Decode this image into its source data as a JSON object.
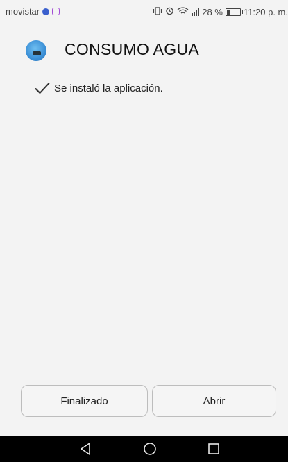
{
  "status_bar": {
    "carrier": "movistar",
    "battery_percent": "28 %",
    "time": "11:20 p. m."
  },
  "header": {
    "app_icon": "app-icon",
    "title": "CONSUMO AGUA"
  },
  "message": {
    "icon": "check-icon",
    "text": "Se instaló la aplicación."
  },
  "buttons": {
    "finish_label": "Finalizado",
    "open_label": "Abrir"
  },
  "nav": {
    "back_icon": "back-icon",
    "home_icon": "home-icon",
    "recent_icon": "recent-apps-icon"
  },
  "colors": {
    "background": "#f3f3f3",
    "nav_bar": "#000000",
    "button_border": "#bdbdbd"
  }
}
